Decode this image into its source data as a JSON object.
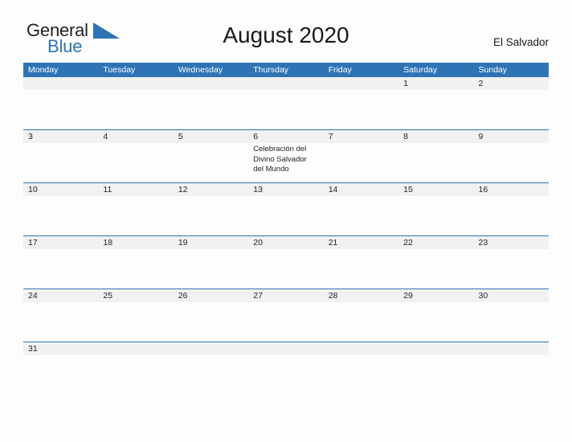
{
  "brand": {
    "name_part1": "General",
    "name_part2": "Blue",
    "flag_icon": "blue-triangle-flag-icon",
    "color_dark": "#231f20",
    "color_blue": "#2e74b5"
  },
  "header": {
    "title": "August 2020",
    "country": "El Salvador"
  },
  "calendar": {
    "accent_color": "#2e74b5",
    "date_band_color": "#f1f1f1",
    "weekdays": [
      "Monday",
      "Tuesday",
      "Wednesday",
      "Thursday",
      "Friday",
      "Saturday",
      "Sunday"
    ],
    "weeks": [
      {
        "days": [
          {
            "date": "",
            "event": ""
          },
          {
            "date": "",
            "event": ""
          },
          {
            "date": "",
            "event": ""
          },
          {
            "date": "",
            "event": ""
          },
          {
            "date": "",
            "event": ""
          },
          {
            "date": "1",
            "event": ""
          },
          {
            "date": "2",
            "event": ""
          }
        ]
      },
      {
        "days": [
          {
            "date": "3",
            "event": ""
          },
          {
            "date": "4",
            "event": ""
          },
          {
            "date": "5",
            "event": ""
          },
          {
            "date": "6",
            "event": "Celebración del Divino Salvador del Mundo"
          },
          {
            "date": "7",
            "event": ""
          },
          {
            "date": "8",
            "event": ""
          },
          {
            "date": "9",
            "event": ""
          }
        ]
      },
      {
        "days": [
          {
            "date": "10",
            "event": ""
          },
          {
            "date": "11",
            "event": ""
          },
          {
            "date": "12",
            "event": ""
          },
          {
            "date": "13",
            "event": ""
          },
          {
            "date": "14",
            "event": ""
          },
          {
            "date": "15",
            "event": ""
          },
          {
            "date": "16",
            "event": ""
          }
        ]
      },
      {
        "days": [
          {
            "date": "17",
            "event": ""
          },
          {
            "date": "18",
            "event": ""
          },
          {
            "date": "19",
            "event": ""
          },
          {
            "date": "20",
            "event": ""
          },
          {
            "date": "21",
            "event": ""
          },
          {
            "date": "22",
            "event": ""
          },
          {
            "date": "23",
            "event": ""
          }
        ]
      },
      {
        "days": [
          {
            "date": "24",
            "event": ""
          },
          {
            "date": "25",
            "event": ""
          },
          {
            "date": "26",
            "event": ""
          },
          {
            "date": "27",
            "event": ""
          },
          {
            "date": "28",
            "event": ""
          },
          {
            "date": "29",
            "event": ""
          },
          {
            "date": "30",
            "event": ""
          }
        ]
      },
      {
        "days": [
          {
            "date": "31",
            "event": ""
          },
          {
            "date": "",
            "event": ""
          },
          {
            "date": "",
            "event": ""
          },
          {
            "date": "",
            "event": ""
          },
          {
            "date": "",
            "event": ""
          },
          {
            "date": "",
            "event": ""
          },
          {
            "date": "",
            "event": ""
          }
        ]
      }
    ]
  }
}
